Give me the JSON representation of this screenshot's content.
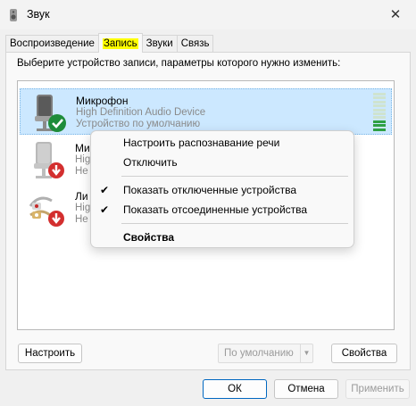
{
  "window": {
    "title": "Звук",
    "close_icon": "close-icon"
  },
  "tabs": [
    {
      "label": "Воспроизведение"
    },
    {
      "label": "Запись"
    },
    {
      "label": "Звуки"
    },
    {
      "label": "Связь"
    }
  ],
  "panel": {
    "instruction": "Выберите устройство записи, параметры которого нужно изменить:",
    "devices": [
      {
        "name": "Микрофон",
        "sub": "High Definition Audio Device",
        "status": "Устройство по умолчанию",
        "icon": "microphone-icon",
        "badge": "default-check-icon",
        "level": 0.3
      },
      {
        "name": "Ми",
        "sub": "Hig",
        "status": "Не",
        "icon": "microphone-icon",
        "badge": "disabled-arrow-icon"
      },
      {
        "name": "Ли",
        "sub": "Hig",
        "status": "Не",
        "icon": "line-in-icon",
        "badge": "disabled-arrow-icon"
      }
    ]
  },
  "buttons": {
    "configure": "Настроить",
    "default_select": "По умолчанию",
    "properties": "Свойства",
    "ok": "ОК",
    "cancel": "Отмена",
    "apply": "Применить"
  },
  "context_menu": {
    "items": [
      {
        "label": "Настроить распознавание речи",
        "checked": false
      },
      {
        "label": "Отключить",
        "checked": false
      },
      {
        "label": "Показать отключенные устройства",
        "checked": true
      },
      {
        "label": "Показать отсоединенные устройства",
        "checked": true
      },
      {
        "label": "Свойства",
        "checked": false,
        "bold": true
      }
    ],
    "check_mark": "✔"
  },
  "colors": {
    "selection": "#cce8ff",
    "level_on": "#2ea043",
    "highlight": "#ffff00",
    "accent": "#0067c0"
  }
}
